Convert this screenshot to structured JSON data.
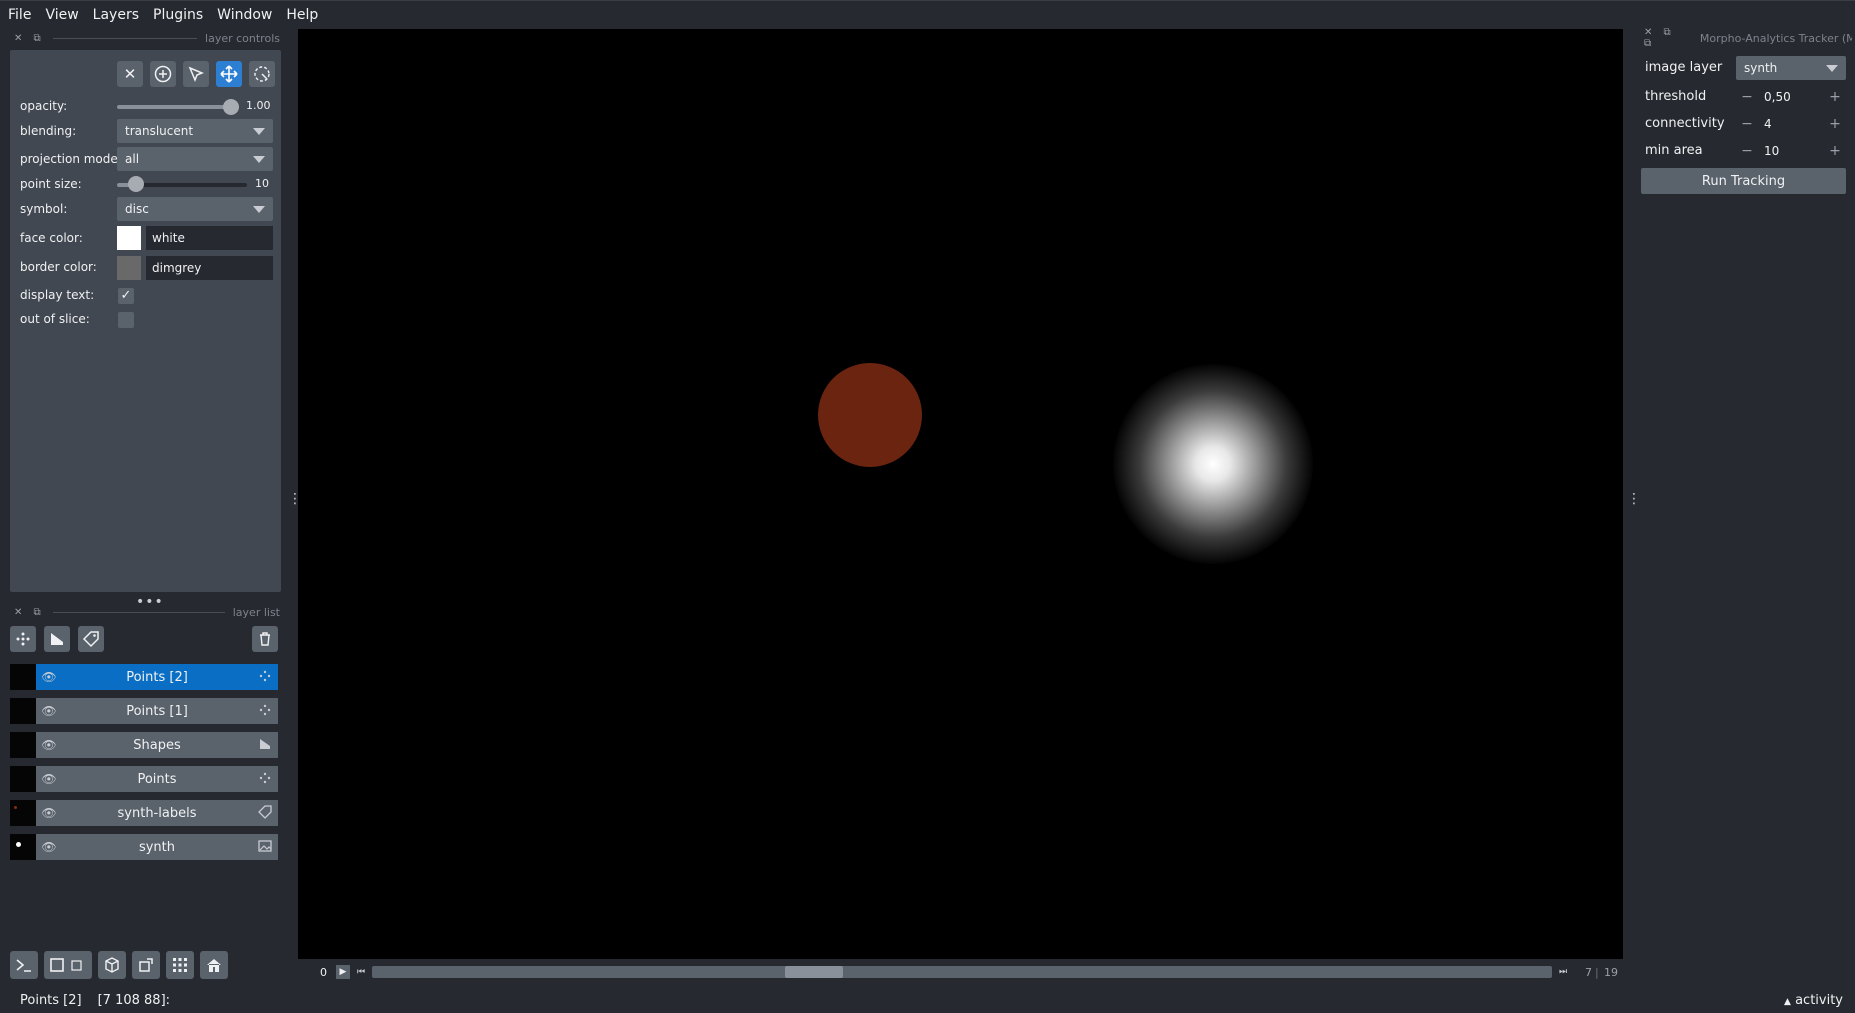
{
  "menu": [
    "File",
    "View",
    "Layers",
    "Plugins",
    "Window",
    "Help"
  ],
  "layer_controls": {
    "title": "layer controls",
    "opacity_label": "opacity:",
    "opacity_value": "1.00",
    "opacity_fraction": 1.0,
    "blending_label": "blending:",
    "blending_value": "translucent",
    "projection_label": "projection mode:",
    "projection_value": "all",
    "point_size_label": "point size:",
    "point_size_value": "10",
    "point_size_fraction": 0.1,
    "symbol_label": "symbol:",
    "symbol_value": "disc",
    "face_color_label": "face color:",
    "face_color_value": "white",
    "face_color_hex": "#ffffff",
    "border_color_label": "border color:",
    "border_color_value": "dimgrey",
    "border_color_hex": "#696969",
    "display_text_label": "display text:",
    "display_text_checked": true,
    "out_of_slice_label": "out of slice:",
    "out_of_slice_checked": false
  },
  "layer_list": {
    "title": "layer list",
    "layers": [
      {
        "name": "Points [2]",
        "type_icon": "points-icon",
        "selected": true
      },
      {
        "name": "Points [1]",
        "type_icon": "points-icon",
        "selected": false
      },
      {
        "name": "Shapes",
        "type_icon": "shapes-icon",
        "selected": false
      },
      {
        "name": "Points",
        "type_icon": "points-icon",
        "selected": false
      },
      {
        "name": "synth-labels",
        "type_icon": "labels-icon",
        "selected": false
      },
      {
        "name": "synth",
        "type_icon": "image-icon",
        "selected": false
      }
    ]
  },
  "plugin": {
    "title": "Morpho-Analytics Tracker (M",
    "image_layer_label": "image layer",
    "image_layer_value": "synth",
    "threshold_label": "threshold",
    "threshold_value": "0,50",
    "connectivity_label": "connectivity",
    "connectivity_value": "4",
    "min_area_label": "min area",
    "min_area_value": "10",
    "run_label": "Run Tracking"
  },
  "slider": {
    "start": "0",
    "current": "7",
    "total": "19"
  },
  "status": {
    "layer": "Points [2]",
    "coords": "[7 108 88]:",
    "activity": "activity"
  },
  "colors": {
    "accent": "#0a6fc4",
    "label_blob": "#6b2410",
    "canvas_bg": "#000000"
  }
}
